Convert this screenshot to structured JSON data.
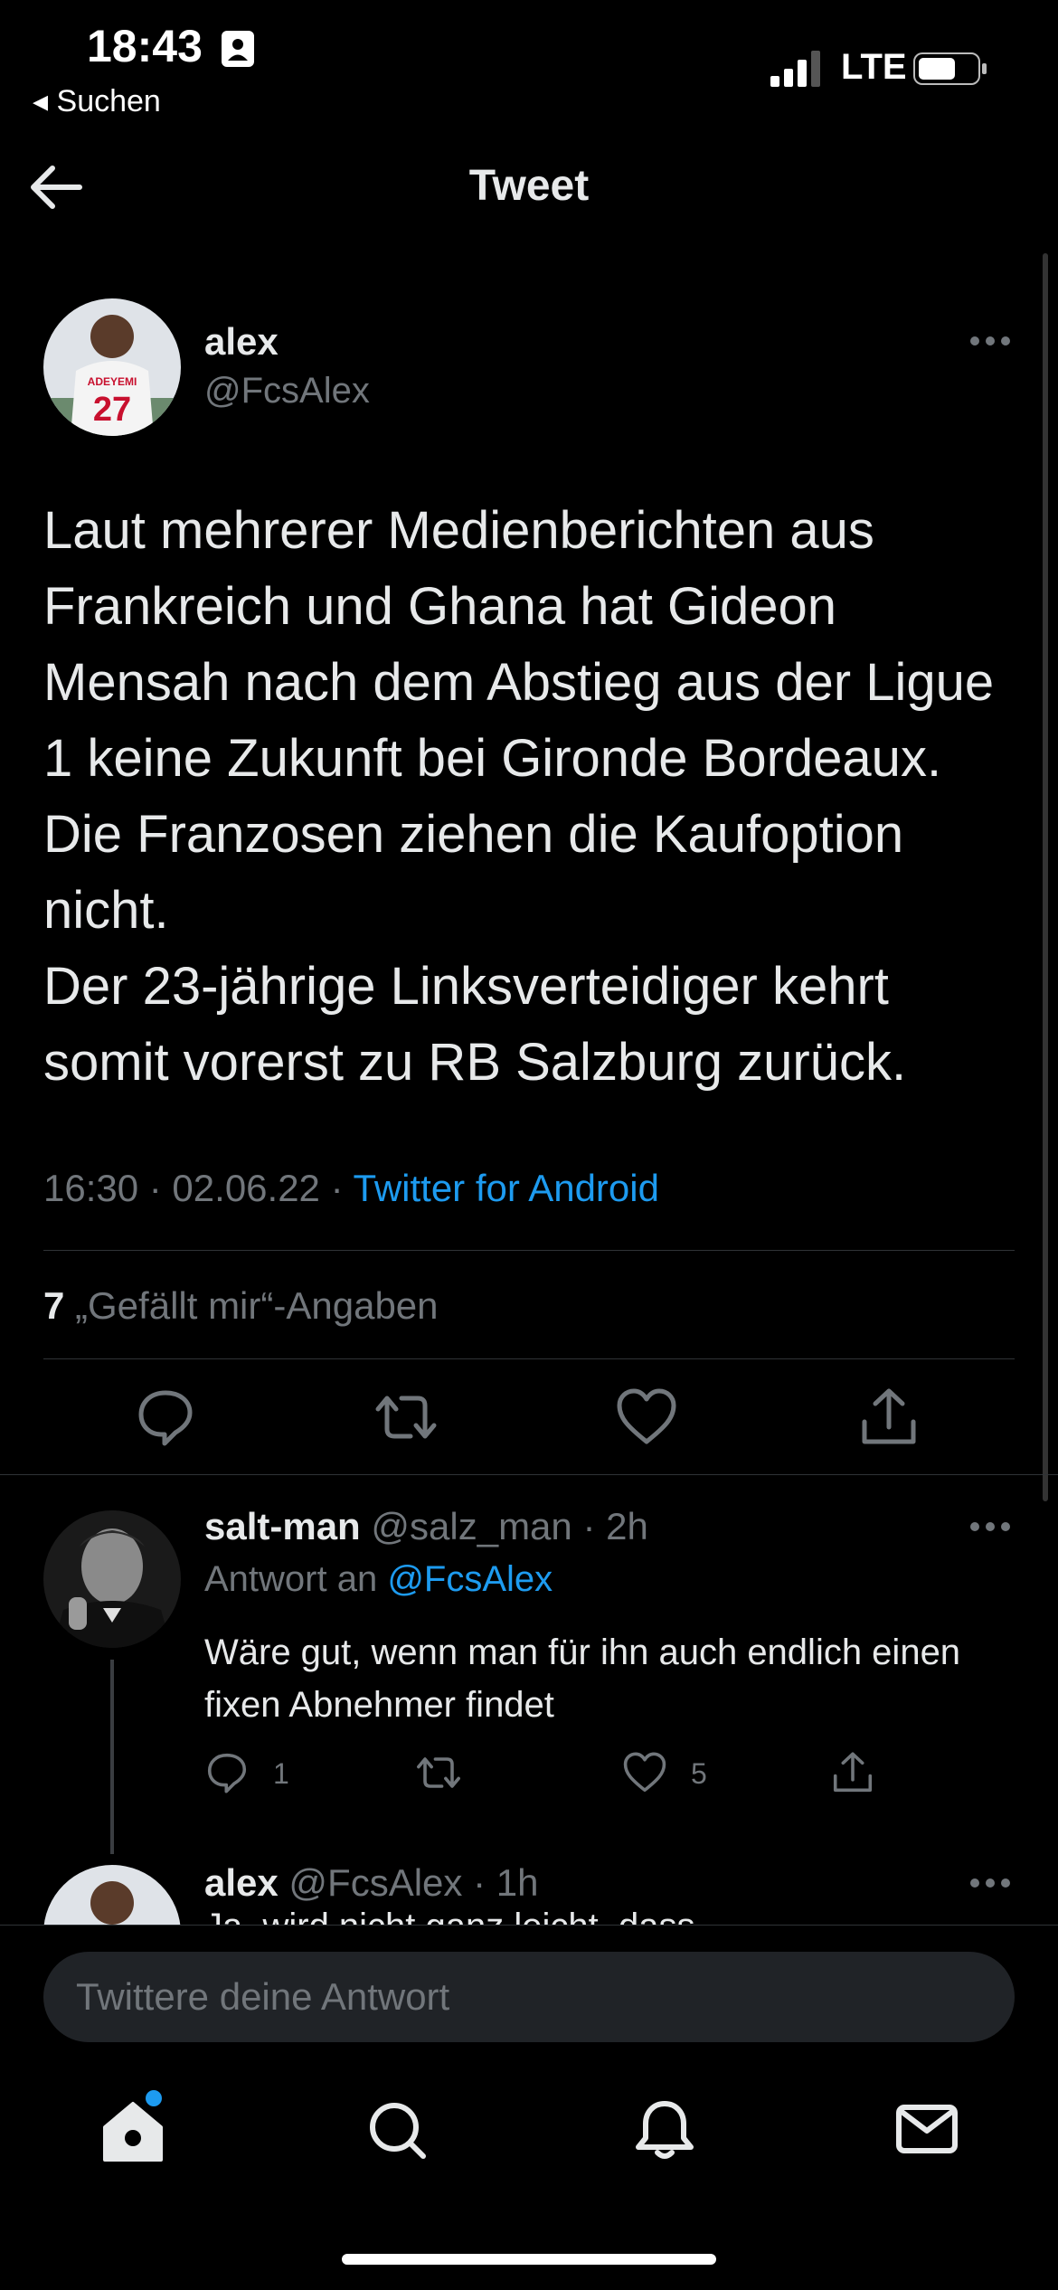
{
  "status_bar": {
    "time": "18:43",
    "back_app": "◂ Suchen",
    "network": "LTE"
  },
  "header": {
    "title": "Tweet"
  },
  "tweet": {
    "author_name": "alex",
    "author_handle": "@FcsAlex",
    "text": "Laut mehrerer Medienberichten aus Frankreich und Ghana hat Gideon Mensah nach dem Abstieg aus der Ligue 1 keine Zukunft bei Gironde Bordeaux. Die Franzosen ziehen die Kaufoption nicht.\nDer 23-jährige Linksverteidiger kehrt somit vorerst zu RB Salzburg zurück.",
    "timestamp": "16:30 · 02.06.22 · ",
    "source": "Twitter for Android",
    "like_count": "7",
    "like_label": "„Gefällt mir“-Angaben"
  },
  "reply": {
    "author_name": "salt-man",
    "author_handle": "@salz_man",
    "time": "· 2h",
    "reply_to_prefix": "Antwort an ",
    "reply_to_handle": "@FcsAlex",
    "text": "Wäre gut, wenn man für ihn auch endlich einen fixen Abnehmer findet",
    "reply_count": "1",
    "like_count": "5"
  },
  "partial_reply": {
    "author_name": "alex",
    "author_handle": "@FcsAlex",
    "time": "· 1h",
    "text_fragment": "Ja, wird nicht ganz leicht, dass..."
  },
  "reply_input": {
    "placeholder": "Twittere deine Antwort"
  },
  "colors": {
    "background": "#000000",
    "text": "#e7e9ea",
    "muted": "#71767b",
    "accent": "#1d9bf0",
    "divider": "#2f3336"
  },
  "icons": {
    "back": "arrow-left-icon",
    "more": "more-dots-icon",
    "reply": "reply-bubble-icon",
    "retweet": "retweet-icon",
    "like": "heart-icon",
    "share": "share-icon",
    "home": "home-icon",
    "search": "search-icon",
    "notifications": "bell-icon",
    "messages": "mail-icon"
  }
}
